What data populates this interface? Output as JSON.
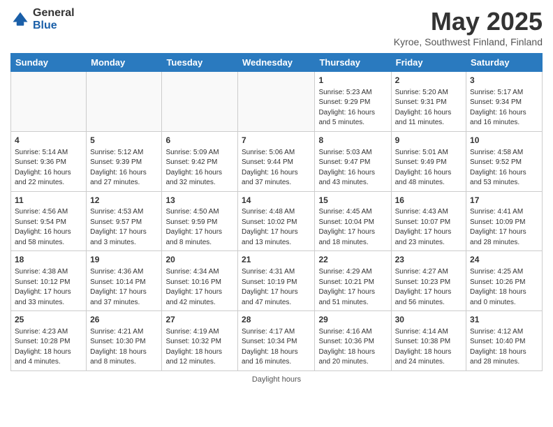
{
  "header": {
    "logo_general": "General",
    "logo_blue": "Blue",
    "month": "May 2025",
    "location": "Kyroe, Southwest Finland, Finland"
  },
  "days_of_week": [
    "Sunday",
    "Monday",
    "Tuesday",
    "Wednesday",
    "Thursday",
    "Friday",
    "Saturday"
  ],
  "weeks": [
    [
      {
        "day": "",
        "info": ""
      },
      {
        "day": "",
        "info": ""
      },
      {
        "day": "",
        "info": ""
      },
      {
        "day": "",
        "info": ""
      },
      {
        "day": "1",
        "info": "Sunrise: 5:23 AM\nSunset: 9:29 PM\nDaylight: 16 hours\nand 5 minutes."
      },
      {
        "day": "2",
        "info": "Sunrise: 5:20 AM\nSunset: 9:31 PM\nDaylight: 16 hours\nand 11 minutes."
      },
      {
        "day": "3",
        "info": "Sunrise: 5:17 AM\nSunset: 9:34 PM\nDaylight: 16 hours\nand 16 minutes."
      }
    ],
    [
      {
        "day": "4",
        "info": "Sunrise: 5:14 AM\nSunset: 9:36 PM\nDaylight: 16 hours\nand 22 minutes."
      },
      {
        "day": "5",
        "info": "Sunrise: 5:12 AM\nSunset: 9:39 PM\nDaylight: 16 hours\nand 27 minutes."
      },
      {
        "day": "6",
        "info": "Sunrise: 5:09 AM\nSunset: 9:42 PM\nDaylight: 16 hours\nand 32 minutes."
      },
      {
        "day": "7",
        "info": "Sunrise: 5:06 AM\nSunset: 9:44 PM\nDaylight: 16 hours\nand 37 minutes."
      },
      {
        "day": "8",
        "info": "Sunrise: 5:03 AM\nSunset: 9:47 PM\nDaylight: 16 hours\nand 43 minutes."
      },
      {
        "day": "9",
        "info": "Sunrise: 5:01 AM\nSunset: 9:49 PM\nDaylight: 16 hours\nand 48 minutes."
      },
      {
        "day": "10",
        "info": "Sunrise: 4:58 AM\nSunset: 9:52 PM\nDaylight: 16 hours\nand 53 minutes."
      }
    ],
    [
      {
        "day": "11",
        "info": "Sunrise: 4:56 AM\nSunset: 9:54 PM\nDaylight: 16 hours\nand 58 minutes."
      },
      {
        "day": "12",
        "info": "Sunrise: 4:53 AM\nSunset: 9:57 PM\nDaylight: 17 hours\nand 3 minutes."
      },
      {
        "day": "13",
        "info": "Sunrise: 4:50 AM\nSunset: 9:59 PM\nDaylight: 17 hours\nand 8 minutes."
      },
      {
        "day": "14",
        "info": "Sunrise: 4:48 AM\nSunset: 10:02 PM\nDaylight: 17 hours\nand 13 minutes."
      },
      {
        "day": "15",
        "info": "Sunrise: 4:45 AM\nSunset: 10:04 PM\nDaylight: 17 hours\nand 18 minutes."
      },
      {
        "day": "16",
        "info": "Sunrise: 4:43 AM\nSunset: 10:07 PM\nDaylight: 17 hours\nand 23 minutes."
      },
      {
        "day": "17",
        "info": "Sunrise: 4:41 AM\nSunset: 10:09 PM\nDaylight: 17 hours\nand 28 minutes."
      }
    ],
    [
      {
        "day": "18",
        "info": "Sunrise: 4:38 AM\nSunset: 10:12 PM\nDaylight: 17 hours\nand 33 minutes."
      },
      {
        "day": "19",
        "info": "Sunrise: 4:36 AM\nSunset: 10:14 PM\nDaylight: 17 hours\nand 37 minutes."
      },
      {
        "day": "20",
        "info": "Sunrise: 4:34 AM\nSunset: 10:16 PM\nDaylight: 17 hours\nand 42 minutes."
      },
      {
        "day": "21",
        "info": "Sunrise: 4:31 AM\nSunset: 10:19 PM\nDaylight: 17 hours\nand 47 minutes."
      },
      {
        "day": "22",
        "info": "Sunrise: 4:29 AM\nSunset: 10:21 PM\nDaylight: 17 hours\nand 51 minutes."
      },
      {
        "day": "23",
        "info": "Sunrise: 4:27 AM\nSunset: 10:23 PM\nDaylight: 17 hours\nand 56 minutes."
      },
      {
        "day": "24",
        "info": "Sunrise: 4:25 AM\nSunset: 10:26 PM\nDaylight: 18 hours\nand 0 minutes."
      }
    ],
    [
      {
        "day": "25",
        "info": "Sunrise: 4:23 AM\nSunset: 10:28 PM\nDaylight: 18 hours\nand 4 minutes."
      },
      {
        "day": "26",
        "info": "Sunrise: 4:21 AM\nSunset: 10:30 PM\nDaylight: 18 hours\nand 8 minutes."
      },
      {
        "day": "27",
        "info": "Sunrise: 4:19 AM\nSunset: 10:32 PM\nDaylight: 18 hours\nand 12 minutes."
      },
      {
        "day": "28",
        "info": "Sunrise: 4:17 AM\nSunset: 10:34 PM\nDaylight: 18 hours\nand 16 minutes."
      },
      {
        "day": "29",
        "info": "Sunrise: 4:16 AM\nSunset: 10:36 PM\nDaylight: 18 hours\nand 20 minutes."
      },
      {
        "day": "30",
        "info": "Sunrise: 4:14 AM\nSunset: 10:38 PM\nDaylight: 18 hours\nand 24 minutes."
      },
      {
        "day": "31",
        "info": "Sunrise: 4:12 AM\nSunset: 10:40 PM\nDaylight: 18 hours\nand 28 minutes."
      }
    ]
  ],
  "footer": "Daylight hours"
}
